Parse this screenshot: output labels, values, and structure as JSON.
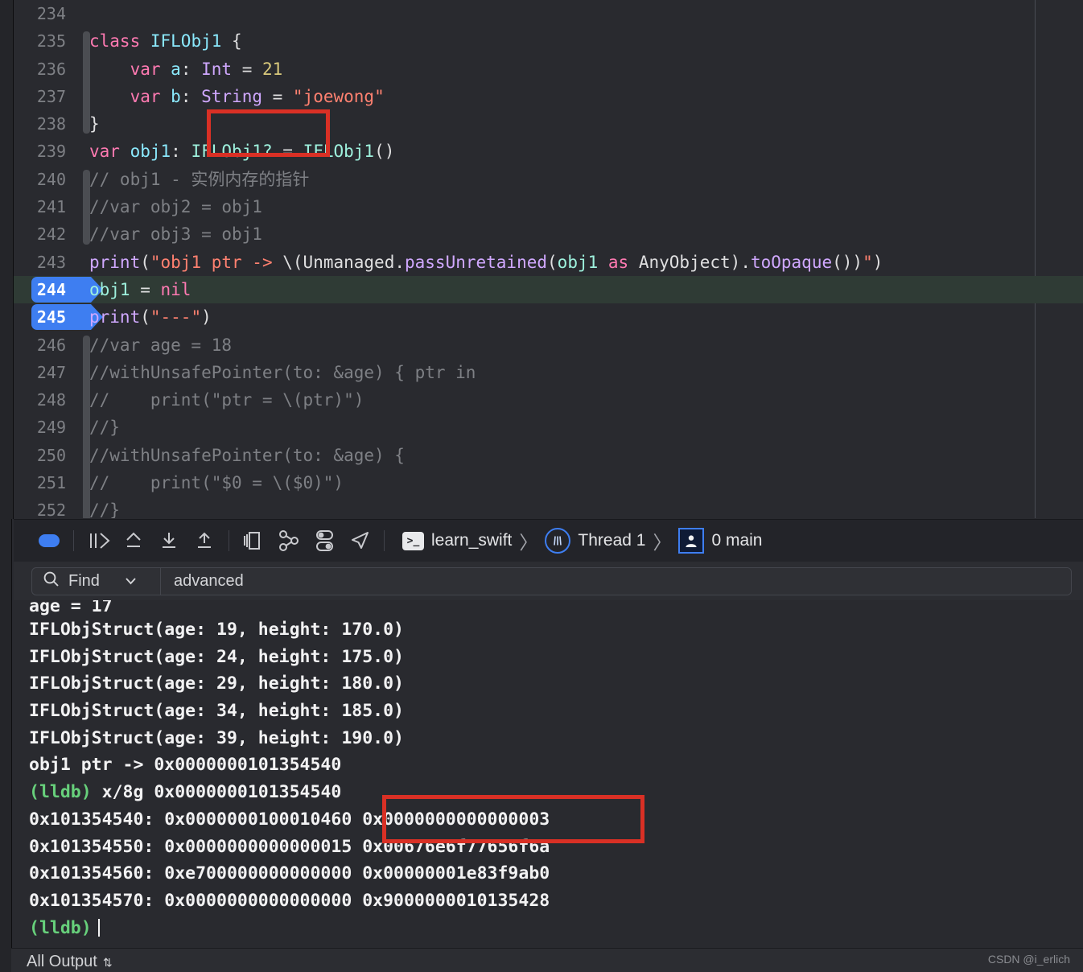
{
  "editor": {
    "lines": [
      {
        "num": "234",
        "ribbon": false,
        "tokens": []
      },
      {
        "num": "235",
        "ribbon": true,
        "tokens": [
          {
            "t": "class",
            "c": "kw"
          },
          {
            "t": " ",
            "c": "plain"
          },
          {
            "t": "IFLObj1",
            "c": "var"
          },
          {
            "t": " {",
            "c": "plain"
          }
        ]
      },
      {
        "num": "236",
        "ribbon": true,
        "tokens": [
          {
            "t": "    ",
            "c": "plain"
          },
          {
            "t": "var",
            "c": "kw"
          },
          {
            "t": " ",
            "c": "plain"
          },
          {
            "t": "a",
            "c": "var"
          },
          {
            "t": ": ",
            "c": "plain"
          },
          {
            "t": "Int",
            "c": "stype"
          },
          {
            "t": " = ",
            "c": "plain"
          },
          {
            "t": "21",
            "c": "num"
          }
        ]
      },
      {
        "num": "237",
        "ribbon": true,
        "tokens": [
          {
            "t": "    ",
            "c": "plain"
          },
          {
            "t": "var",
            "c": "kw"
          },
          {
            "t": " ",
            "c": "plain"
          },
          {
            "t": "b",
            "c": "var"
          },
          {
            "t": ": ",
            "c": "plain"
          },
          {
            "t": "String",
            "c": "stype"
          },
          {
            "t": " = ",
            "c": "plain"
          },
          {
            "t": "\"joewong\"",
            "c": "str"
          }
        ]
      },
      {
        "num": "238",
        "ribbon": true,
        "tokens": [
          {
            "t": "}",
            "c": "plain"
          }
        ]
      },
      {
        "num": "239",
        "ribbon": false,
        "tokens": [
          {
            "t": "var",
            "c": "kw"
          },
          {
            "t": " ",
            "c": "plain"
          },
          {
            "t": "obj1",
            "c": "var"
          },
          {
            "t": ": ",
            "c": "plain"
          },
          {
            "t": "IFLObj1",
            "c": "grn"
          },
          {
            "t": "?",
            "c": "grn"
          },
          {
            "t": " = ",
            "c": "plain"
          },
          {
            "t": "IFLObj1",
            "c": "grn"
          },
          {
            "t": "()",
            "c": "plain"
          }
        ]
      },
      {
        "num": "240",
        "ribbon": true,
        "tokens": [
          {
            "t": "// obj1 - 实例内存的指针",
            "c": "cmt"
          }
        ]
      },
      {
        "num": "241",
        "ribbon": true,
        "tokens": [
          {
            "t": "//var obj2 = obj1",
            "c": "cmt"
          }
        ]
      },
      {
        "num": "242",
        "ribbon": true,
        "tokens": [
          {
            "t": "//var obj3 = obj1",
            "c": "cmt"
          }
        ]
      },
      {
        "num": "243",
        "ribbon": false,
        "tokens": [
          {
            "t": "print",
            "c": "stype"
          },
          {
            "t": "(",
            "c": "plain"
          },
          {
            "t": "\"obj1 ptr -> ",
            "c": "str"
          },
          {
            "t": "\\(",
            "c": "plain"
          },
          {
            "t": "Unmanaged",
            "c": "plain"
          },
          {
            "t": ".",
            "c": "plain"
          },
          {
            "t": "passUnretained",
            "c": "stype"
          },
          {
            "t": "(",
            "c": "plain"
          },
          {
            "t": "obj1",
            "c": "grn"
          },
          {
            "t": " ",
            "c": "plain"
          },
          {
            "t": "as",
            "c": "kw"
          },
          {
            "t": " ",
            "c": "plain"
          },
          {
            "t": "AnyObject",
            "c": "plain"
          },
          {
            "t": ")",
            "c": "plain"
          },
          {
            "t": ".",
            "c": "plain"
          },
          {
            "t": "toOpaque",
            "c": "stype"
          },
          {
            "t": "())",
            "c": "plain"
          },
          {
            "t": "\"",
            "c": "str"
          },
          {
            "t": ")",
            "c": "plain"
          }
        ]
      },
      {
        "num": "244",
        "ribbon": false,
        "breakpoint": true,
        "current": true,
        "tokens": [
          {
            "t": "obj1",
            "c": "grn"
          },
          {
            "t": " = ",
            "c": "plain"
          },
          {
            "t": "nil",
            "c": "kw"
          }
        ]
      },
      {
        "num": "245",
        "ribbon": false,
        "breakpoint": true,
        "tokens": [
          {
            "t": "print",
            "c": "stype"
          },
          {
            "t": "(",
            "c": "plain"
          },
          {
            "t": "\"---\"",
            "c": "str"
          },
          {
            "t": ")",
            "c": "plain"
          }
        ]
      },
      {
        "num": "246",
        "ribbon": true,
        "tokens": [
          {
            "t": "//var age = 18",
            "c": "cmt"
          }
        ]
      },
      {
        "num": "247",
        "ribbon": true,
        "tokens": [
          {
            "t": "//withUnsafePointer(to: &age) { ptr in",
            "c": "cmt"
          }
        ]
      },
      {
        "num": "248",
        "ribbon": true,
        "tokens": [
          {
            "t": "//    print(\"ptr = \\(ptr)\")",
            "c": "cmt"
          }
        ]
      },
      {
        "num": "249",
        "ribbon": true,
        "tokens": [
          {
            "t": "//}",
            "c": "cmt"
          }
        ]
      },
      {
        "num": "250",
        "ribbon": true,
        "tokens": [
          {
            "t": "//withUnsafePointer(to: &age) {",
            "c": "cmt"
          }
        ]
      },
      {
        "num": "251",
        "ribbon": true,
        "tokens": [
          {
            "t": "//    print(\"$0 = \\($0)\")",
            "c": "cmt"
          }
        ]
      },
      {
        "num": "252",
        "ribbon": true,
        "tokens": [
          {
            "t": "//}",
            "c": "cmt"
          }
        ]
      }
    ]
  },
  "debugbar": {
    "icons": [
      {
        "name": "continue-pause-button",
        "glyph": "continue"
      },
      {
        "name": "step-over-button",
        "glyph": "step-over"
      },
      {
        "name": "step-into-button",
        "glyph": "step-into"
      },
      {
        "name": "step-out-button",
        "glyph": "step-out"
      },
      {
        "name": "view-hierarchy-button",
        "glyph": "layers"
      },
      {
        "name": "memory-graph-button",
        "glyph": "graph"
      },
      {
        "name": "environment-overrides-button",
        "glyph": "toggles"
      },
      {
        "name": "simulate-location-button",
        "glyph": "location"
      }
    ],
    "breadcrumb": {
      "process": "learn_swift",
      "thread": "Thread 1",
      "frame": "0 main",
      "chevron": "〉"
    }
  },
  "findbar": {
    "scope_label": "Find",
    "query": "advanced",
    "chevron": "⌄"
  },
  "console": {
    "lines": [
      {
        "text": "age = 17",
        "cls": "clip"
      },
      {
        "text": "IFLObjStruct(age: 19, height: 170.0)"
      },
      {
        "text": "IFLObjStruct(age: 24, height: 175.0)"
      },
      {
        "text": "IFLObjStruct(age: 29, height: 180.0)"
      },
      {
        "text": "IFLObjStruct(age: 34, height: 185.0)"
      },
      {
        "text": "IFLObjStruct(age: 39, height: 190.0)"
      },
      {
        "text": "obj1 ptr -> 0x0000000101354540"
      },
      {
        "prompt": "(lldb)",
        "text": " x/8g 0x0000000101354540"
      },
      {
        "text": "0x101354540: 0x0000000100010460 0x0000000000000003"
      },
      {
        "text": "0x101354550: 0x0000000000000015 0x00676e6f77656f6a"
      },
      {
        "text": "0x101354560: 0xe700000000000000 0x00000001e83f9ab0"
      },
      {
        "text": "0x101354570: 0x0000000000000000 0x9000000010135428"
      },
      {
        "prompt": "(lldb)",
        "text": "",
        "caret": true
      }
    ]
  },
  "bottombar": {
    "filter_label": "All Output",
    "stepper": "⇅",
    "watermark": "CSDN @i_erlich"
  },
  "colors": {
    "accent_blue": "#3e7ef1",
    "annotation_red": "#d93025",
    "current_line_green": "#2f3b35",
    "editor_bg": "#292a2f",
    "console_green": "#67d07b"
  }
}
